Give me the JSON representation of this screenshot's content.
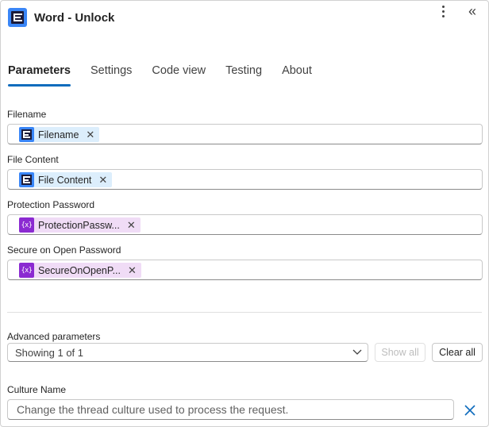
{
  "header": {
    "title": "Word - Unlock",
    "more_icon": "more-vertical-icon",
    "collapse_icon": "double-chevron-left-icon",
    "collapse_glyph": "«"
  },
  "tabs": [
    {
      "label": "Parameters",
      "active": true
    },
    {
      "label": "Settings",
      "active": false
    },
    {
      "label": "Code view",
      "active": false
    },
    {
      "label": "Testing",
      "active": false
    },
    {
      "label": "About",
      "active": false
    }
  ],
  "fields": [
    {
      "label": "Filename",
      "token": {
        "text": "Filename",
        "type": "connector-output",
        "icon": "encodian-logo-icon"
      }
    },
    {
      "label": "File Content",
      "token": {
        "text": "File Content",
        "type": "connector-output",
        "icon": "encodian-logo-icon"
      }
    },
    {
      "label": "Protection Password",
      "token": {
        "text": "ProtectionPassw...",
        "type": "variable",
        "icon": "variable-icon",
        "glyph": "{x}"
      }
    },
    {
      "label": "Secure on Open Password",
      "token": {
        "text": "SecureOnOpenP...",
        "type": "variable",
        "icon": "variable-icon",
        "glyph": "{x}"
      }
    }
  ],
  "token_remove_glyph": "✕",
  "advanced": {
    "label": "Advanced parameters",
    "selected": "Showing 1 of 1",
    "show_all_label": "Show all",
    "clear_all_label": "Clear all"
  },
  "culture": {
    "label": "Culture Name",
    "placeholder": "Change the thread culture used to process the request."
  },
  "colors": {
    "accent": "#0f6cbd",
    "connector_icon": "#3a86f7",
    "variable_icon": "#8b2ad1",
    "connector_token_bg": "#dceefc",
    "variable_token_bg": "#f0dcf6"
  }
}
